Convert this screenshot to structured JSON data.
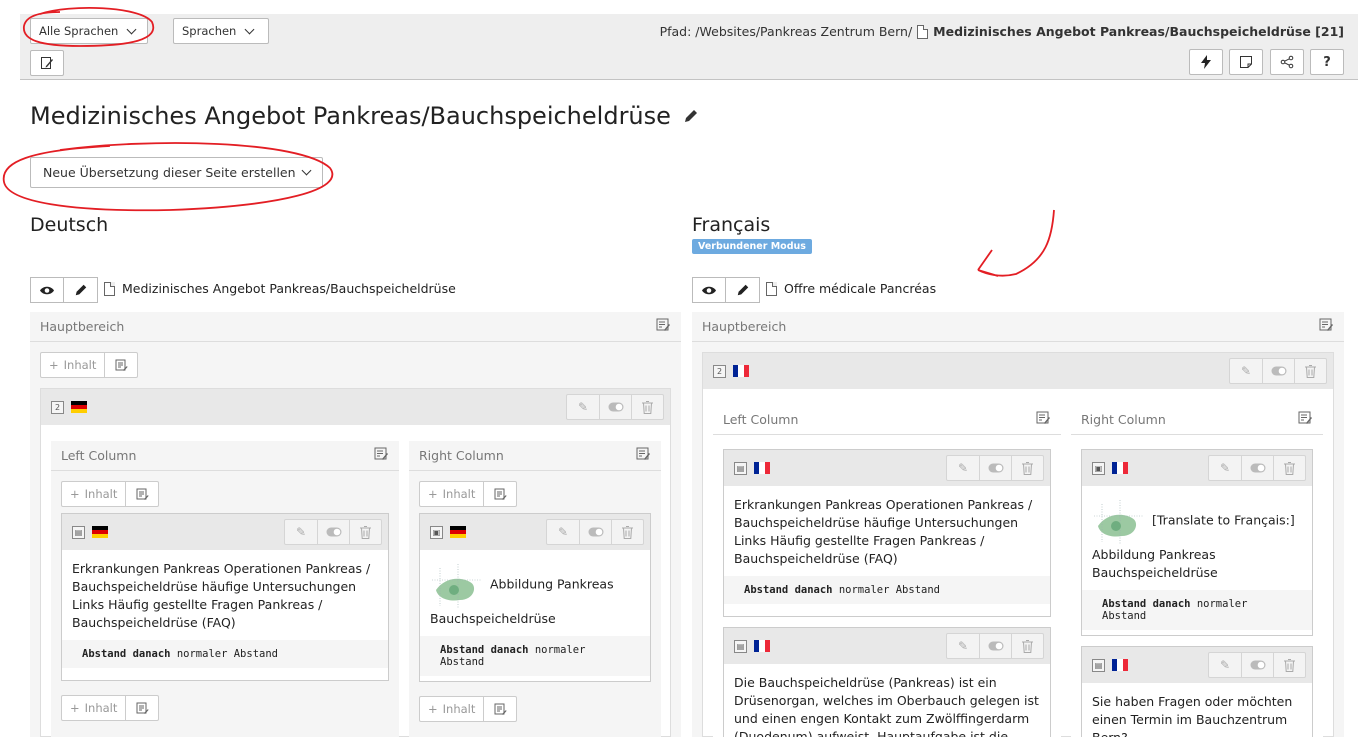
{
  "header": {
    "language_select": "Alle Sprachen",
    "view_select": "Sprachen",
    "path_label": "Pfad: /Websites/Pankreas Zentrum Bern/",
    "path_page": "Medizinisches Angebot Pankreas/Bauchspeicheldrüse [21]",
    "action_icons": [
      "flash-icon",
      "note-icon",
      "share-icon",
      "help-icon"
    ],
    "help_label": "?"
  },
  "page": {
    "title": "Medizinisches Angebot Pankreas/Bauchspeicheldrüse",
    "new_translation": "Neue Übersetzung dieser Seite erstellen"
  },
  "de": {
    "heading": "Deutsch",
    "page_ref": "Medizinisches Angebot Pankreas/Bauchspeicheldrüse",
    "area": "Hauptbereich",
    "add_content": "Inhalt",
    "left_col": "Left Column",
    "right_col": "Right Column",
    "ce_left_text": "Erkrankungen Pankreas Operationen Pankreas / Bauchspeicheldrüse häufige Untersuchungen Links Häufig gestellte Fragen Pankreas / Bauchspeicheldrüse (FAQ)",
    "ce_right_text1": "Abbildung Pankreas",
    "ce_right_text2": "Bauchspeicheldrüse",
    "spacing_key": "Abstand danach",
    "spacing_val": "normaler Abstand"
  },
  "fr": {
    "heading": "Français",
    "mode_badge": "Verbundener Modus",
    "page_ref": "Offre médicale Pancréas",
    "area": "Hauptbereich",
    "left_col": "Left Column",
    "right_col": "Right Column",
    "ce_left_text": "Erkrankungen Pankreas Operationen Pankreas / Bauchspeicheldrüse häufige Untersuchungen Links Häufig gestellte Fragen Pankreas / Bauchspeicheldrüse (FAQ)",
    "ce_right_prefix": "[Translate to Français:]",
    "ce_right_text": "Abbildung Pankreas Bauchspeicheldrüse",
    "ce_left2_text": "Die Bauchspeicheldrüse (Pankreas) ist ein Drüsenorgan, welches im Oberbauch gelegen ist und einen engen Kontakt zum Zwölffingerdarm (Duodenum) aufweist. Hauptaufgabe ist die",
    "ce_right2_text": "Sie haben Fragen oder möchten einen Termin im Bauchzentrum Bern?",
    "spacing_key": "Abstand danach",
    "spacing_val": "normaler Abstand"
  },
  "colors": {
    "badge": "#6daae0",
    "annotation": "#e31e24",
    "header_bg": "#eeeeee"
  }
}
